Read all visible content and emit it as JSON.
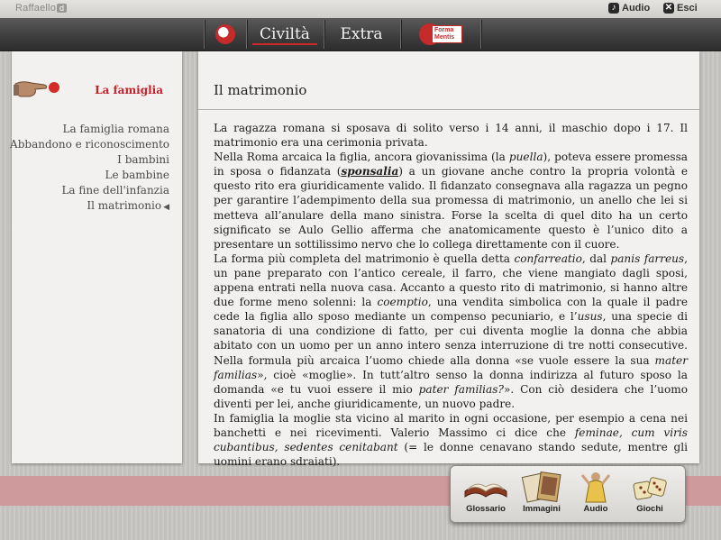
{
  "topbar": {
    "brand": "Raffaello",
    "brand_badge": "d",
    "audio_label": "Audio",
    "exit_label": "Esci"
  },
  "nav": {
    "items": [
      {
        "label": "Civiltà",
        "active": true
      },
      {
        "label": "Extra",
        "active": false
      }
    ],
    "forma_mentis_label": "Forma Mentis"
  },
  "sidebar": {
    "title": "La famiglia",
    "items": [
      {
        "label": "La famiglia romana"
      },
      {
        "label": "Abbandono e riconoscimento"
      },
      {
        "label": "I bambini"
      },
      {
        "label": "Le bambine"
      },
      {
        "label": "La fine dell'infanzia"
      },
      {
        "label": "Il matrimonio",
        "current": true
      }
    ]
  },
  "main": {
    "title": "Il matrimonio",
    "article": {
      "p1": "La ragazza romana si sposava di solito verso i 14 anni, il maschio dopo i 17. Il matrimonio era una cerimonia privata.",
      "p2_a": "Nella Roma arcaica la figlia, ancora giovanissima (la ",
      "p2_puella": "puella",
      "p2_b": "), poteva essere promessa in sposa o fidanzata (",
      "p2_link": "sponsalia",
      "p2_c": ") a un giovane anche contro la propria volontà e questo rito era giuridicamente valido. Il fidanzato consegnava alla ragazza un pegno per garantire l’adempimento della sua promessa di matrimonio, un anello che lei si metteva all’anulare della mano sinistra. Forse la scelta di quel dito ha un certo significato se Aulo Gellio afferma che anatomicamente questo è l’unico dito a presentare un sottilissimo nervo che lo collega direttamente con il cuore.",
      "p3_a": "La forma più completa del matrimonio è quella detta ",
      "p3_confarreatio": "confarreatio",
      "p3_b": ", dal ",
      "p3_panis": "panis farreus",
      "p3_c": ", un pane preparato con l’antico cereale, il farro, che viene mangiato dagli sposi, appena entrati nella nuova casa. Accanto a questo rito di matrimonio, si hanno altre due forme meno solenni: la ",
      "p3_coemptio": "coemptio",
      "p3_d": ", una vendita simbolica con la quale il padre cede la figlia allo sposo mediante un compenso pecuniario, e l’",
      "p3_usus": "usus",
      "p3_e": ", una specie di sanatoria di una condizione di fatto, per cui diventa moglie la donna che abbia abitato con un uomo per un anno intero senza interruzione di tre notti consecutive. Nella formula più arcaica l’uomo chiede alla donna «se vuole essere la sua ",
      "p3_mater": "mater familias",
      "p3_f": "», cioè «moglie». In tutt’altro senso la donna indirizza al futuro sposo la domanda «e tu vuoi essere il mio ",
      "p3_pater": "pater familias?",
      "p3_g": "». Con ciò desidera che l’uomo diventi per lei, anche giuridicamente, un nuovo padre.",
      "p4_a": "In famiglia la moglie sta vicino al marito in ogni occasione, per esempio a cena nei banchetti e nei ricevimenti. Valerio Massimo ci dice che ",
      "p4_feminae": "feminae, cum viris cubantibus, sedentes cenitabant",
      "p4_b": " (= le donne cenavano stando sedute, mentre gli uomini erano sdraiati)."
    }
  },
  "tools": [
    {
      "label": "Glossario",
      "icon": "book-icon"
    },
    {
      "label": "Immagini",
      "icon": "images-icon"
    },
    {
      "label": "Audio",
      "icon": "audio-icon"
    },
    {
      "label": "Giochi",
      "icon": "dice-icon"
    }
  ],
  "colors": {
    "accent": "#c8202a",
    "navbar": "#3c3c3c",
    "panel": "#f2f1ef",
    "stripe": "#cf9a9c"
  }
}
